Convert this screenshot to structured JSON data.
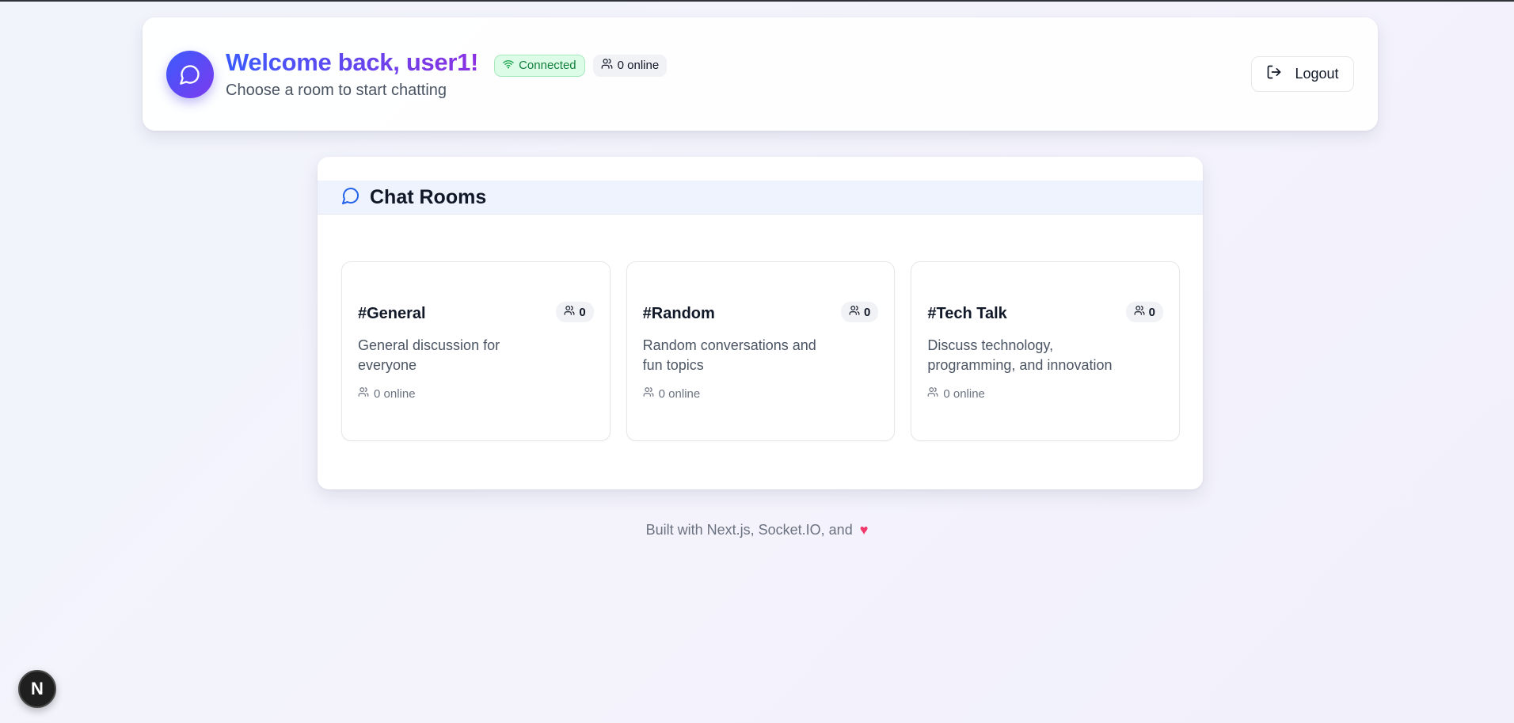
{
  "header": {
    "title": "Welcome back, user1!",
    "subtitle": "Choose a room to start chatting",
    "status": "Connected",
    "online": "0 online",
    "logout_label": "Logout",
    "icons": {
      "avatar": "chat-bubble-icon",
      "status": "wifi-icon",
      "online": "users-icon",
      "logout": "log-out-icon"
    }
  },
  "rooms_panel": {
    "title": "Chat Rooms",
    "rooms": [
      {
        "name": "#General",
        "count": "0",
        "description": "General discussion for everyone",
        "online": "0 online"
      },
      {
        "name": "#Random",
        "count": "0",
        "description": "Random conversations and fun topics",
        "online": "0 online"
      },
      {
        "name": "#Tech Talk",
        "count": "0",
        "description": "Discuss technology, programming, and innovation",
        "online": "0 online"
      }
    ]
  },
  "footer": {
    "text": "Built with Next.js, Socket.IO, and",
    "heart": "♥"
  },
  "dev_badge": {
    "label": "N"
  },
  "colors": {
    "accent_start": "#3b5bfd",
    "accent_end": "#8b32e0",
    "connected": "#15803d",
    "connected_bg": "#dcfce7"
  }
}
